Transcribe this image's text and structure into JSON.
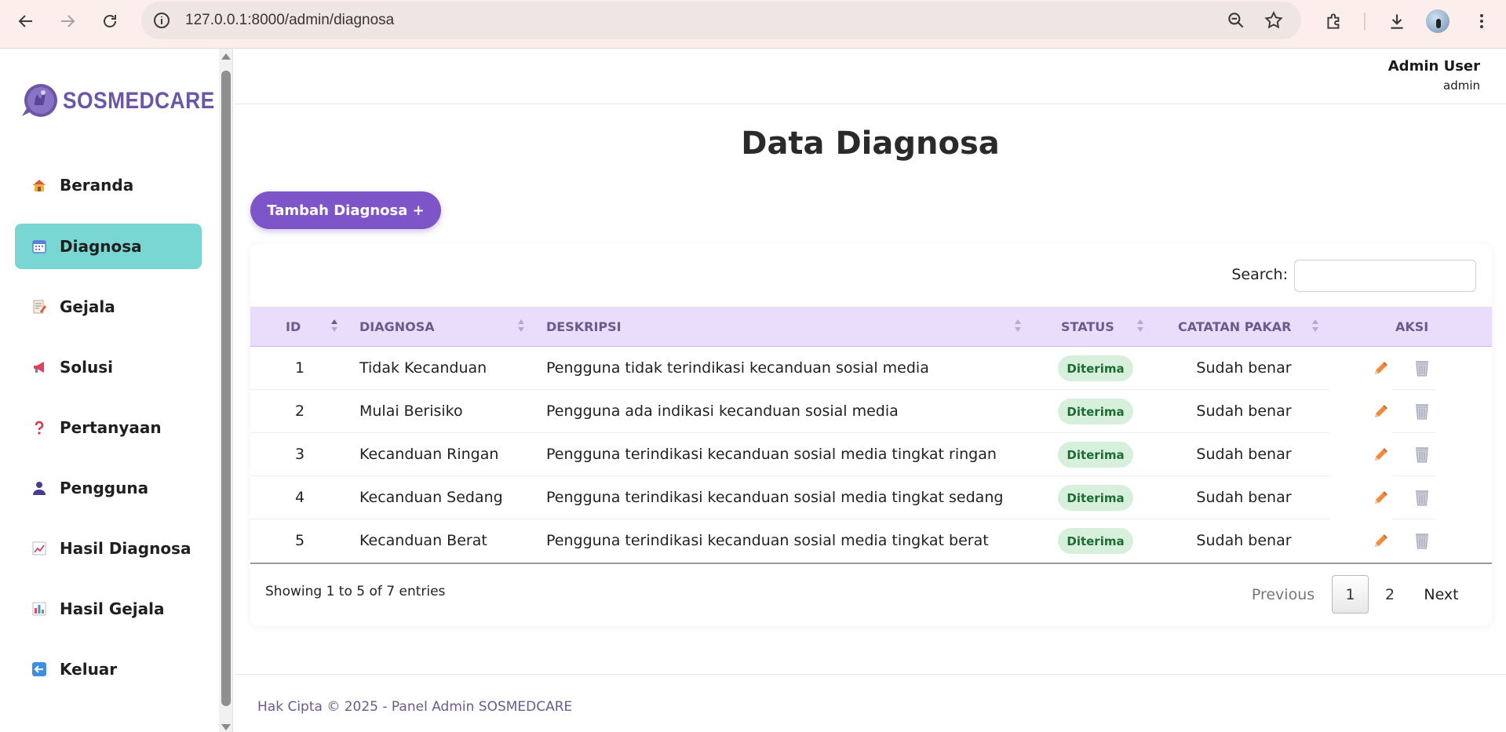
{
  "browser": {
    "url": "127.0.0.1:8000/admin/diagnosa"
  },
  "sidebar": {
    "brand": "SOSMEDCARE",
    "items": [
      {
        "label": "Beranda",
        "icon": "house-icon"
      },
      {
        "label": "Diagnosa",
        "icon": "calendar-icon",
        "active": true
      },
      {
        "label": "Gejala",
        "icon": "memo-icon"
      },
      {
        "label": "Solusi",
        "icon": "megaphone-icon"
      },
      {
        "label": "Pertanyaan",
        "icon": "question-icon"
      },
      {
        "label": "Pengguna",
        "icon": "user-icon"
      },
      {
        "label": "Hasil Diagnosa",
        "icon": "line-chart-icon"
      },
      {
        "label": "Hasil Gejala",
        "icon": "bar-chart-icon"
      },
      {
        "label": "Keluar",
        "icon": "back-arrow-icon"
      }
    ]
  },
  "topbar": {
    "user_name": "Admin User",
    "user_role": "admin"
  },
  "page": {
    "title": "Data Diagnosa",
    "add_button": "Tambah Diagnosa +"
  },
  "table": {
    "search_label": "Search:",
    "search_value": "",
    "columns": [
      "ID",
      "DIAGNOSA",
      "DESKRIPSI",
      "STATUS",
      "CATATAN PAKAR",
      "AKSI"
    ],
    "rows": [
      {
        "id": "1",
        "diagnosa": "Tidak Kecanduan",
        "deskripsi": "Pengguna tidak terindikasi kecanduan sosial media",
        "status": "Diterima",
        "catatan": "Sudah benar"
      },
      {
        "id": "2",
        "diagnosa": "Mulai Berisiko",
        "deskripsi": "Pengguna ada indikasi kecanduan sosial media",
        "status": "Diterima",
        "catatan": "Sudah benar"
      },
      {
        "id": "3",
        "diagnosa": "Kecanduan Ringan",
        "deskripsi": "Pengguna terindikasi kecanduan sosial media tingkat ringan",
        "status": "Diterima",
        "catatan": "Sudah benar"
      },
      {
        "id": "4",
        "diagnosa": "Kecanduan Sedang",
        "deskripsi": "Pengguna terindikasi kecanduan sosial media tingkat sedang",
        "status": "Diterima",
        "catatan": "Sudah benar"
      },
      {
        "id": "5",
        "diagnosa": "Kecanduan Berat",
        "deskripsi": "Pengguna terindikasi kecanduan sosial media tingkat berat",
        "status": "Diterima",
        "catatan": "Sudah benar"
      }
    ],
    "info": "Showing 1 to 5 of 7 entries",
    "pagination": {
      "previous": "Previous",
      "current": "1",
      "page2": "2",
      "next": "Next"
    }
  },
  "footer": {
    "text": "Hak Cipta © 2025 - Panel Admin SOSMEDCARE"
  },
  "colors": {
    "accent": "#7e55c9",
    "active_menu": "#78d7d3",
    "table_header": "#eadcfb",
    "badge_bg": "#d7f0dc",
    "badge_text": "#1d6b33"
  }
}
